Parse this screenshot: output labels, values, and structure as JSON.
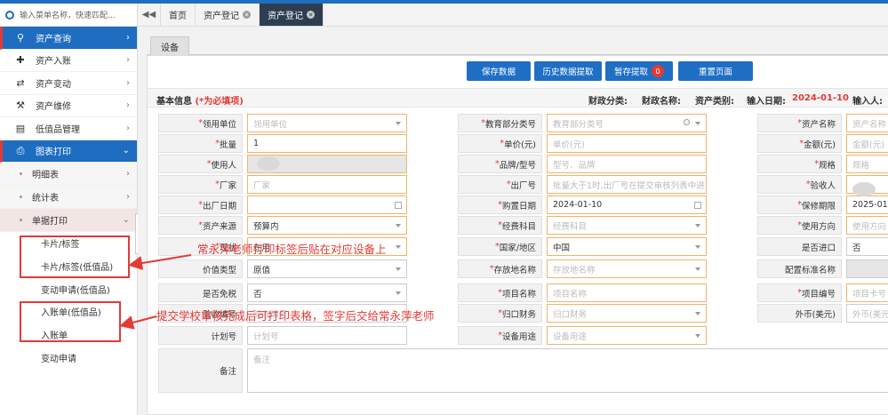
{
  "search": {
    "placeholder": "输入菜单名称，快速匹配..."
  },
  "sidebar": {
    "menu": [
      {
        "label": "资产查询",
        "icon": "search-icon",
        "active": true
      },
      {
        "label": "资产入账",
        "icon": "plus-icon",
        "active": false
      },
      {
        "label": "资产变动",
        "icon": "shuffle-icon",
        "active": false
      },
      {
        "label": "资产维修",
        "icon": "wrench-icon",
        "active": false
      },
      {
        "label": "低值品管理",
        "icon": "money-icon",
        "active": false
      },
      {
        "label": "图表打印",
        "icon": "printer-icon",
        "active": true
      }
    ],
    "sub": [
      "明细表",
      "统计表",
      "单据打印"
    ],
    "leaves": [
      "卡片/标签",
      "卡片/标签(低值品)",
      "变动申请(低值品)",
      "入账单(低值品)",
      "入账单",
      "变动申请"
    ]
  },
  "tabs": {
    "home": "首页",
    "tab1": "资产登记",
    "tab2": "资产登记"
  },
  "subtab": "设备",
  "buttons": {
    "save": "保存数据",
    "history": "历史数据提取",
    "stash": "暂存提取",
    "stash_count": "0",
    "reset": "重置页面"
  },
  "info": {
    "title": "基本信息",
    "required_note": "(*为必填项)",
    "finance_class": "财政分类:",
    "finance_name": "财政名称:",
    "asset_type": "资产类别:",
    "entry_date_label": "输入日期:",
    "entry_date": "2024-01-10",
    "entry_person": "输入人:"
  },
  "form": {
    "c1": [
      {
        "label": "领用单位",
        "req": true,
        "value": "",
        "ph": "领用单位"
      },
      {
        "label": "批量",
        "req": true,
        "value": "1",
        "ph": ""
      },
      {
        "label": "使用人",
        "req": true,
        "value": "",
        "ph": ""
      },
      {
        "label": "厂家",
        "req": true,
        "value": "",
        "ph": "厂家"
      },
      {
        "label": "出厂日期",
        "req": true,
        "value": "",
        "ph": ""
      },
      {
        "label": "资产来源",
        "req": true,
        "value": "预算内",
        "ph": ""
      },
      {
        "label": "现状",
        "req": true,
        "value": "在用",
        "ph": ""
      },
      {
        "label": "价值类型",
        "req": false,
        "value": "原值",
        "ph": ""
      },
      {
        "label": "是否免税",
        "req": false,
        "value": "否",
        "ph": ""
      },
      {
        "label": "验收编号",
        "req": false,
        "value": "",
        "ph": "验收编号"
      },
      {
        "label": "计划号",
        "req": false,
        "value": "",
        "ph": "计划号"
      },
      {
        "label": "备注",
        "req": false,
        "value": "",
        "ph": "备注"
      }
    ],
    "c2": [
      {
        "label": "教育部分类号",
        "req": true,
        "value": "",
        "ph": "教育部分类号"
      },
      {
        "label": "单价(元)",
        "req": true,
        "value": "",
        "ph": "单价(元)"
      },
      {
        "label": "品牌/型号",
        "req": true,
        "value": "",
        "ph": "型号、品牌"
      },
      {
        "label": "出厂号",
        "req": true,
        "value": "",
        "ph": "批量大于1时,出厂号在提交审核列表中进"
      },
      {
        "label": "购置日期",
        "req": true,
        "value": "2024-01-10",
        "ph": ""
      },
      {
        "label": "经费科目",
        "req": true,
        "value": "",
        "ph": "经费科目"
      },
      {
        "label": "国家/地区",
        "req": true,
        "value": "中国",
        "ph": ""
      },
      {
        "label": "存放地名称",
        "req": true,
        "value": "",
        "ph": "存放地名称"
      },
      {
        "label": "项目名称",
        "req": true,
        "value": "",
        "ph": "项目名称"
      },
      {
        "label": "归口财务",
        "req": true,
        "value": "",
        "ph": "归口财务"
      },
      {
        "label": "设备用途",
        "req": true,
        "value": "",
        "ph": "设备用途"
      }
    ],
    "c3": [
      {
        "label": "资产名称",
        "req": true,
        "value": "",
        "ph": "资产名称"
      },
      {
        "label": "金额(元)",
        "req": true,
        "value": "",
        "ph": "金额(元)"
      },
      {
        "label": "规格",
        "req": true,
        "value": "",
        "ph": "规格"
      },
      {
        "label": "验收人",
        "req": true,
        "value": "",
        "ph": ""
      },
      {
        "label": "保修期限",
        "req": true,
        "value": "2025-01-1",
        "ph": ""
      },
      {
        "label": "使用方向",
        "req": true,
        "value": "",
        "ph": "使用方向"
      },
      {
        "label": "是否进口",
        "req": false,
        "value": "否",
        "ph": ""
      },
      {
        "label": "配置标准名称",
        "req": false,
        "value": "",
        "ph": ""
      },
      {
        "label": "项目编号",
        "req": true,
        "value": "",
        "ph": "项目卡号"
      },
      {
        "label": "外币(美元)",
        "req": false,
        "value": "",
        "ph": "外币(美元"
      }
    ]
  },
  "annotations": {
    "a1": "常永萍老师打印标签后贴在对应设备上",
    "a2": "提交学校审核完成后可打印表格，签字后交给常永萍老师"
  }
}
